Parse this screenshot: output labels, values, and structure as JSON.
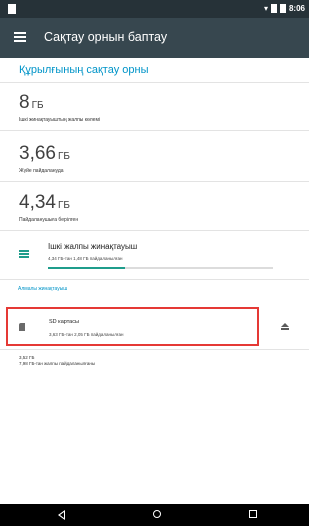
{
  "status_bar": {
    "time": "8:06"
  },
  "toolbar": {
    "title": "Сақтау орнын баптау"
  },
  "device_storage": {
    "header": "Құрылғының сақтау орны",
    "total": {
      "value": "8",
      "unit": "ГБ",
      "label": "Ішкі жинақтауыштың жалпы көлемі"
    },
    "system": {
      "value": "3,66",
      "unit": "ГБ",
      "label": "Жүйе пайдалануда"
    },
    "available": {
      "value": "4,34",
      "unit": "ГБ",
      "label": "Пайдаланушыға берілген"
    }
  },
  "internal_storage": {
    "title": "Ішкі жалпы жинақтауыш",
    "subtitle": "4,34 ГБ-тан 1,48 ГБ пайдаланылған",
    "used_fraction": 0.34
  },
  "portable_storage": {
    "header": "Алмалы жинақтауыш",
    "sd_card": {
      "title": "SD картасы",
      "subtitle": "3,63 ГБ-тан 2,05 ГБ пайдаланылған"
    }
  },
  "summary": {
    "line1": "3,52 ГБ",
    "line2": "7,98 ГБ-тан жалпы пайдаланылғаны"
  },
  "accent_color": "#0094c8",
  "progress_color": "#1f9d8c"
}
